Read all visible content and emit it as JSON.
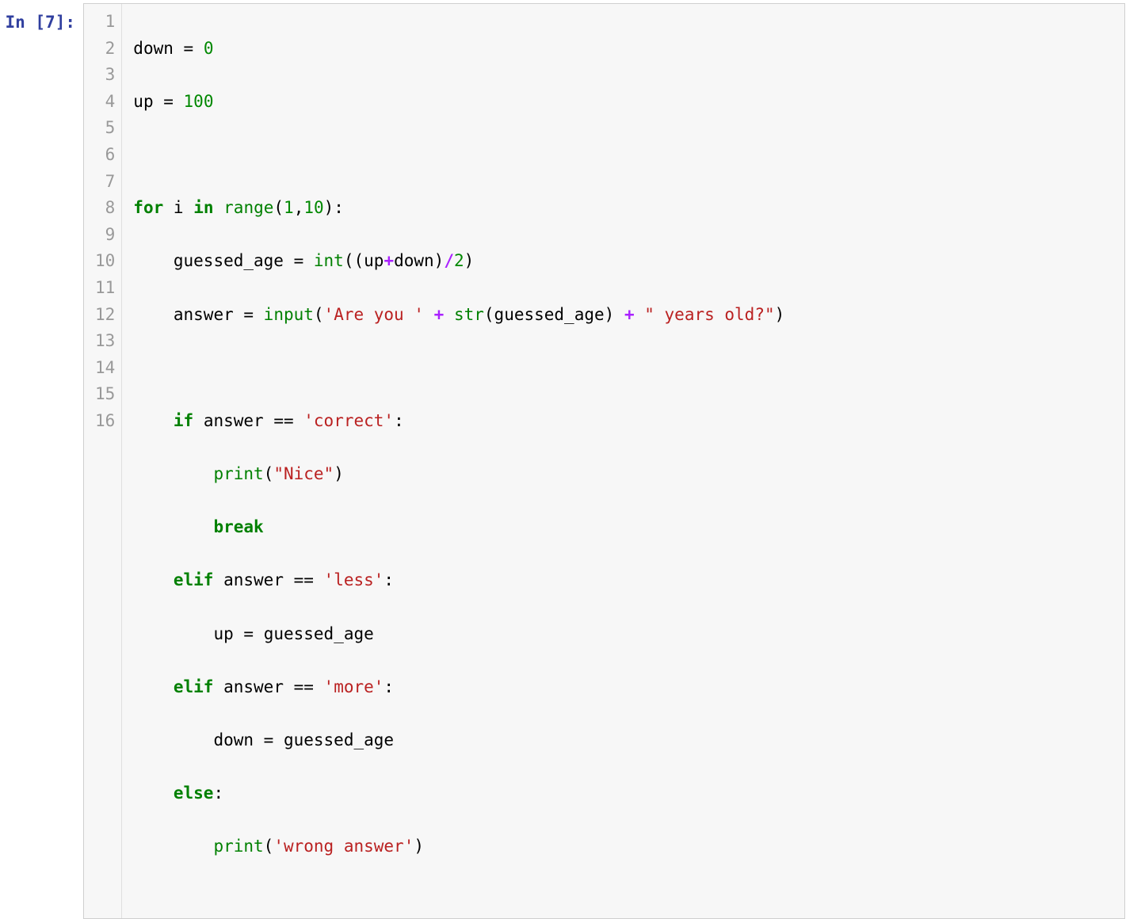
{
  "prompt": {
    "label_in": "In ",
    "open_bracket": "[",
    "exec_count": "7",
    "close_bracket": "]:",
    "full": "In [7]:"
  },
  "code": {
    "numbers": {
      "zero": "0",
      "hundred": "100",
      "one": "1",
      "ten": "10",
      "two": "2"
    },
    "names": {
      "down": "down",
      "up": "up",
      "i": "i",
      "guessed_age": "guessed_age",
      "answer": "answer"
    },
    "builtins": {
      "range": "range",
      "int": "int",
      "input": "input",
      "str": "str",
      "print": "print"
    },
    "keywords": {
      "for": "for",
      "in": "in",
      "if": "if",
      "elif": "elif",
      "else": "else",
      "break": "break"
    },
    "strings": {
      "are_you": "'Are you '",
      "years_old": "\" years old?\"",
      "correct": "'correct'",
      "nice": "\"Nice\"",
      "less": "'less'",
      "more": "'more'",
      "wrong": "'wrong answer'"
    },
    "ops": {
      "assign": " = ",
      "eq": " == ",
      "plus": "+",
      "slash": "/",
      "comma": ",",
      "colon": ":",
      "lparen": "(",
      "rparen": ")"
    }
  },
  "gutter": {
    "lines": [
      "1",
      "2",
      "3",
      "4",
      "5",
      "6",
      "7",
      "8",
      "9",
      "10",
      "11",
      "12",
      "13",
      "14",
      "15",
      "16"
    ]
  }
}
